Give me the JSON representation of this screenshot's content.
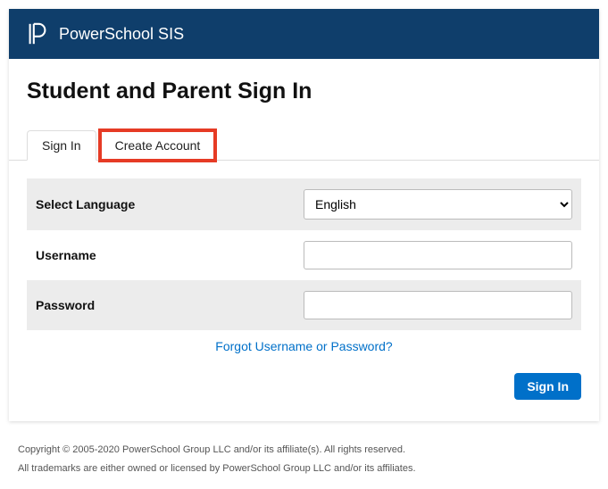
{
  "header": {
    "brand": "PowerSchool SIS"
  },
  "page": {
    "title": "Student and Parent Sign In"
  },
  "tabs": {
    "signin": "Sign In",
    "create": "Create Account"
  },
  "form": {
    "language_label": "Select Language",
    "language_value": "English",
    "username_label": "Username",
    "username_value": "",
    "password_label": "Password",
    "password_value": ""
  },
  "links": {
    "forgot": "Forgot Username or Password?"
  },
  "buttons": {
    "signin": "Sign In"
  },
  "footer": {
    "line1": "Copyright © 2005-2020 PowerSchool Group LLC and/or its affiliate(s). All rights reserved.",
    "line2": "All trademarks are either owned or licensed by PowerSchool Group LLC and/or its affiliates."
  }
}
